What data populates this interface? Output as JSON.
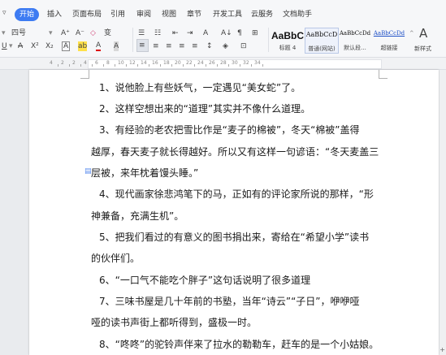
{
  "ribbon": {
    "menu_arrow": "▿",
    "tabs": [
      "开始",
      "插入",
      "页面布局",
      "引用",
      "审阅",
      "视图",
      "章节",
      "开发工具",
      "云服务",
      "文档助手"
    ],
    "active_tab": "开始"
  },
  "toolbar": {
    "font_name": "四号",
    "grow_font": "A⁺",
    "shrink_font": "A⁻",
    "clear_format": "◇",
    "phonetic": "变",
    "underline": "U",
    "underline_arrow": "▾",
    "strike": "A",
    "superscript": "X²",
    "subscript": "X₂",
    "char_border": "A",
    "highlight": "ab",
    "font_color": "A",
    "char_shading": "A",
    "bullets": "☰",
    "numbering": "☷",
    "outdent": "⇤",
    "indent": "⇥",
    "text_dir": "A",
    "sort": "A↓",
    "show_marks": "¶",
    "table_insert": "⊞",
    "align_left": "≡",
    "align_center": "≡",
    "align_right": "≡",
    "align_justify": "≡",
    "distribute": "≡",
    "line_spacing": "↕",
    "shading": "◈",
    "borders": "⊡",
    "styles": [
      {
        "sample": "AaBbC",
        "name": "标题 4"
      },
      {
        "sample": "AaBbCcD",
        "name": "普通(网站)"
      },
      {
        "sample": "AaBbCcDd",
        "name": "默认段..."
      },
      {
        "sample": "AaBbCcDd",
        "name": "超链接"
      }
    ],
    "new_style_label": "新样式",
    "new_style_icon": "A"
  },
  "ruler": {
    "labels": [
      "4",
      "2",
      "2",
      "4",
      "6",
      "8",
      "10",
      "12",
      "14",
      "16",
      "18",
      "20",
      "22",
      "24",
      "26",
      "28",
      "30",
      "32",
      "34"
    ]
  },
  "document": {
    "paragraphs": [
      "1、说他脸上有些妖气，一定遇见“美女蛇”了。",
      "2、这样空想出来的“道理”其实并不像什么道理。",
      "3、有经验的老农把雪比作是“麦子的棉被”，冬天“棉被”盖得",
      "越厚，春天麦子就长得越好。所以又有这样一句谚语：“冬天麦盖三",
      "层被，来年枕着馒头睡。”",
      "4、现代画家徐悲鸿笔下的马，正如有的评论家所说的那样，“形",
      "神兼备，充满生机”。",
      "5、把我们看过的有意义的图书捐出来，寄给在“希望小学”读书",
      "的伙伴们。",
      "6、“一口气不能吃个胖子”这句话说明了很多道理",
      "7、三味书屋是几十年前的书塾，当年“诗云”“子日”，咿咿哑",
      "哑的读书声街上都听得到，盛极一时。",
      "8、“咚咚”的驼铃声伴来了拉水的勒勒车，赶车的是一个小姑娘。"
    ],
    "margin_icon": "▤ ·"
  },
  "corner_mark": "+"
}
